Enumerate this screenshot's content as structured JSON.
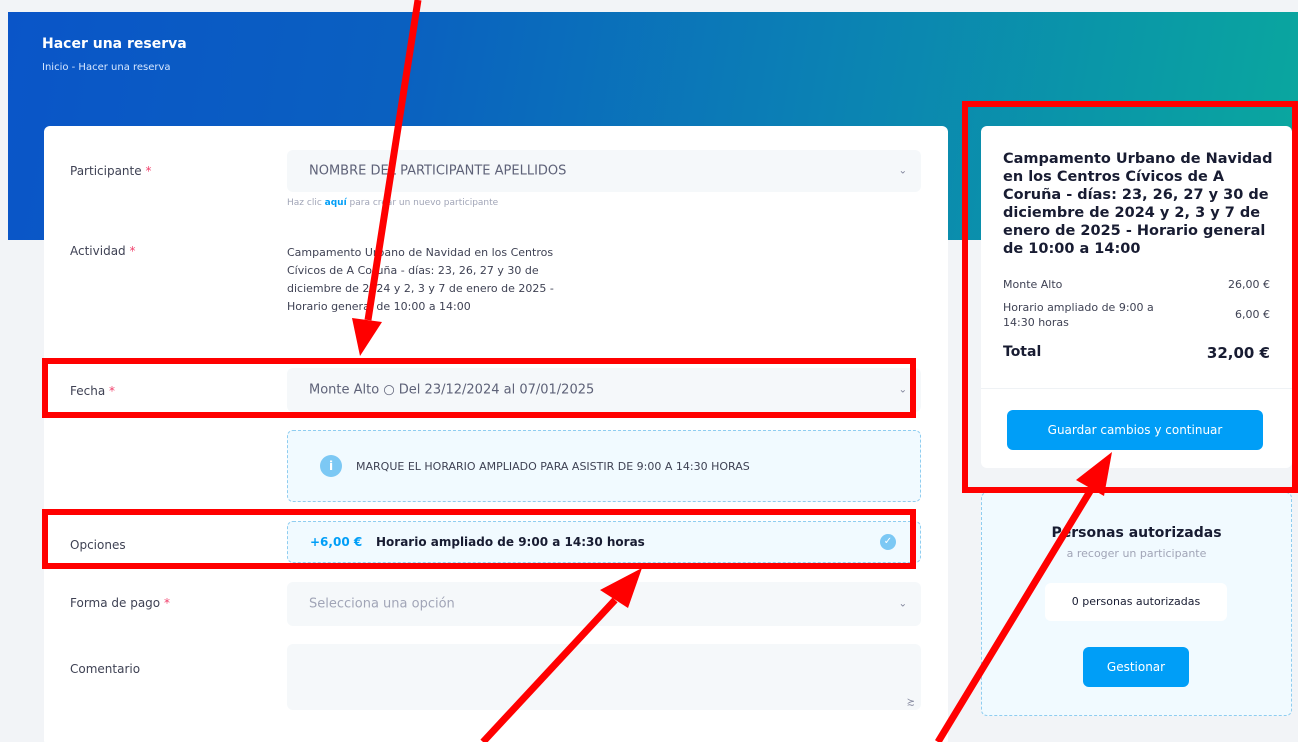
{
  "header": {
    "title": "Hacer una reserva",
    "breadcrumb": "Inicio - Hacer una reserva"
  },
  "form": {
    "participant": {
      "label": "Participante",
      "required": "*",
      "value": "NOMBRE DEL PARTICIPANTE APELLIDOS",
      "helper_pre": "Haz clic ",
      "helper_link": "aquí",
      "helper_post": " para crear un nuevo participante"
    },
    "activity": {
      "label": "Actividad",
      "required": "*",
      "value": "Campamento Urbano de Navidad en los Centros Cívicos de A Coruña - días: 23, 26, 27 y 30 de diciembre de 2024 y 2, 3 y 7 de enero de 2025 - Horario general de 10:00 a 14:00"
    },
    "date": {
      "label": "Fecha",
      "required": "*",
      "value": "Monte Alto ○ Del 23/12/2024 al 07/01/2025"
    },
    "notice": {
      "icon": "info-icon",
      "text": "MARQUE EL HORARIO AMPLIADO PARA ASISTIR DE 9:00 A 14:30 HORAS"
    },
    "options": {
      "label": "Opciones",
      "price": "+6,00 €",
      "name": "Horario ampliado de 9:00 a 14:30 horas",
      "checked": true
    },
    "payment": {
      "label": "Forma de pago",
      "required": "*",
      "placeholder": "Selecciona una opción"
    },
    "comment": {
      "label": "Comentario",
      "value": ""
    }
  },
  "summary": {
    "title": "Campamento Urbano de Navidad en los Centros Cívicos de A Coruña - días: 23, 26, 27 y 30 de diciembre de 2024 y 2, 3 y 7 de enero de 2025 - Horario general de 10:00 a 14:00",
    "lines": [
      {
        "label": "Monte Alto",
        "amount": "26,00 €"
      },
      {
        "label": "Horario ampliado de 9:00 a 14:30 horas",
        "amount": "6,00 €"
      }
    ],
    "total_label": "Total",
    "total_amount": "32,00 €",
    "save_button": "Guardar cambios y continuar"
  },
  "authorized": {
    "title": "Personas autorizadas",
    "subtitle": "a recoger un participante",
    "count": "0 personas autorizadas",
    "manage_button": "Gestionar"
  },
  "colors": {
    "accent": "#009ef7",
    "annotation": "#ff0000",
    "required": "#f1416c"
  }
}
